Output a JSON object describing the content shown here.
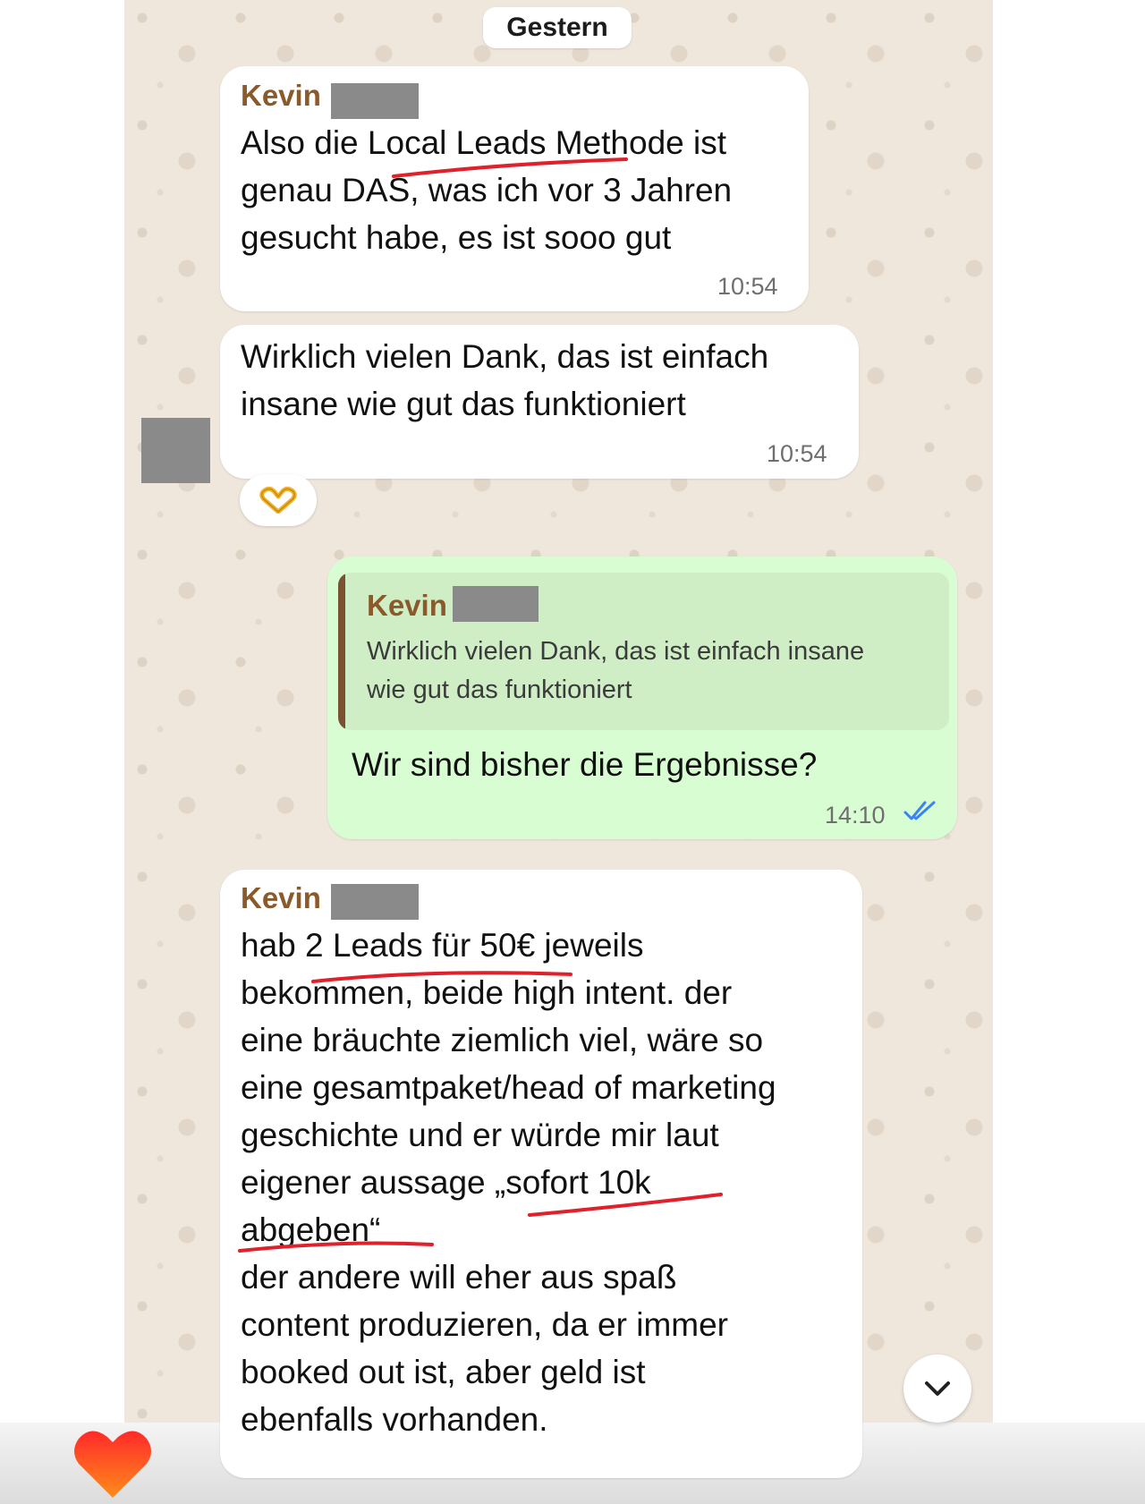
{
  "date_separator": "Gestern",
  "messages": [
    {
      "sender": "Kevin",
      "text": "Also die Local Leads Methode ist\ngenau DAS, was ich vor 3 Jahren\ngesucht habe, es ist sooo gut",
      "time": "10:54"
    },
    {
      "text": "Wirklich vielen Dank, das ist einfach\ninsane wie gut das funktioniert",
      "time": "10:54",
      "reaction": "heart-hands-emoji"
    },
    {
      "quote": {
        "sender": "Kevin",
        "text": "Wirklich vielen Dank, das ist einfach insane\nwie gut das funktioniert"
      },
      "text": "Wir sind bisher die Ergebnisse?",
      "time": "14:10",
      "status": "read-double-check"
    },
    {
      "sender": "Kevin",
      "text": "hab 2 Leads für 50€ jeweils\nbekommen, beide high intent. der\neine bräuchte ziemlich viel, wäre so\neine gesamtpaket/head of marketing\ngeschichte und er würde mir laut\neigener aussage „sofort 10k\nabgeben“\nder andere will eher aus spaß\ncontent produzieren, da er immer\nbooked out ist, aber geld ist\nebenfalls vorhanden."
    }
  ],
  "icons": {
    "scroll_down": "chevron-down-icon",
    "like": "heart-icon",
    "read_status": "double-check-icon"
  },
  "colors": {
    "chat_background": "#efe7dc",
    "incoming_bubble": "#ffffff",
    "outgoing_bubble": "#d9fdd3",
    "sender_name": "#8a5a2b",
    "read_ticks": "#3b82f6",
    "annotation_underline": "#e0202a"
  }
}
